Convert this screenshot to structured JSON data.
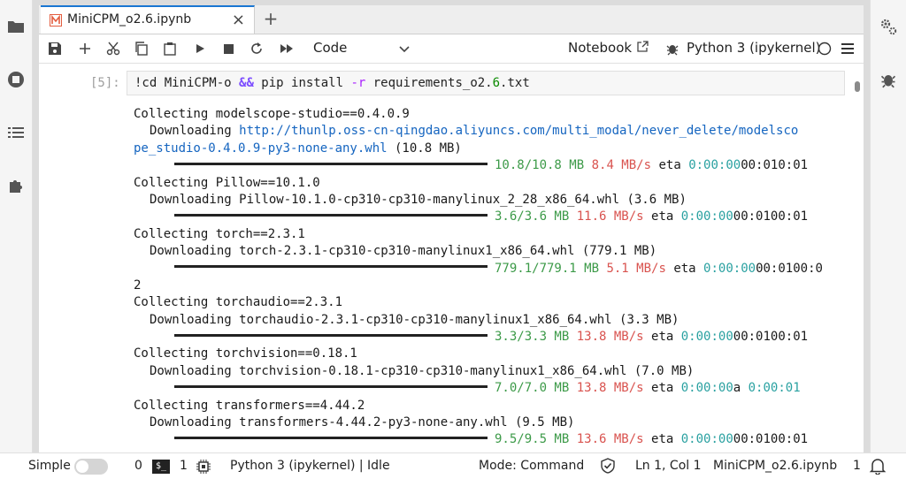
{
  "tab": {
    "label": "MiniCPM_o2.6.ipynb",
    "close": "×",
    "add": "+"
  },
  "toolbar": {
    "cell_type": "Code",
    "notebook_label": "Notebook",
    "kernel_name": "Python 3 (ipykernel)"
  },
  "cell": {
    "prompt": "[5]:",
    "cmd": "!cd MiniCPM-o ",
    "and": "&&",
    "pip": " pip install ",
    "flag": "-r",
    "req1": " requirements_o2.",
    "req_num": "6",
    "req2": ".txt"
  },
  "output": {
    "l1": "Collecting modelscope-studio==0.4.0.9",
    "l2a": "Downloading ",
    "l2b": "http://thunlp.oss-cn-qingdao.aliyuncs.com/multi_modal/never_delete/modelsco",
    "l3a": "pe_studio-0.4.0.9-py3-none-any.whl",
    "l3b": " (10.8 MB)",
    "p1": {
      "size": "10.8/10.8 MB",
      "speed": "8.4 MB/s",
      "eta": " eta ",
      "t1": "0:00:00",
      "t2": "00:010:01"
    },
    "l5": "Collecting Pillow==10.1.0",
    "l6": "Downloading Pillow-10.1.0-cp310-cp310-manylinux_2_28_x86_64.whl (3.6 MB)",
    "p2": {
      "size": "3.6/3.6 MB",
      "speed": "11.6 MB/s",
      "eta": " eta ",
      "t1": "0:00:00",
      "t2": "00:0100:01"
    },
    "l8": "Collecting torch==2.3.1",
    "l9": "Downloading torch-2.3.1-cp310-cp310-manylinux1_x86_64.whl (779.1 MB)",
    "p3": {
      "size": "779.1/779.1 MB",
      "speed": "5.1 MB/s",
      "eta": " eta ",
      "t1": "0:00:00",
      "t2": "00:0100:0"
    },
    "l11": "2",
    "l12": "Collecting torchaudio==2.3.1",
    "l13": "Downloading torchaudio-2.3.1-cp310-cp310-manylinux1_x86_64.whl (3.3 MB)",
    "p4": {
      "size": "3.3/3.3 MB",
      "speed": "13.8 MB/s",
      "eta": " eta ",
      "t1": "0:00:00",
      "t2": "00:0100:01"
    },
    "l15": "Collecting torchvision==0.18.1",
    "l16": "Downloading torchvision-0.18.1-cp310-cp310-manylinux1_x86_64.whl (7.0 MB)",
    "p5": {
      "size": "7.0/7.0 MB",
      "speed": "13.8 MB/s",
      "eta": " eta ",
      "t1": "0:00:00",
      "mid": "a ",
      "t2": "0:00:01"
    },
    "l18": "Collecting transformers==4.44.2",
    "l19": "Downloading transformers-4.44.2-py3-none-any.whl (9.5 MB)",
    "p6": {
      "size": "9.5/9.5 MB",
      "speed": "13.6 MB/s",
      "eta": " eta ",
      "t1": "0:00:00",
      "t2": "00:0100:01"
    }
  },
  "status": {
    "mode_simple": "Simple",
    "terminals": "0",
    "term_glyph": "$_",
    "kernels": "1",
    "kernel_state": "Python 3 (ipykernel) | Idle",
    "mode": "Mode: Command",
    "position": "Ln 1, Col 1",
    "filename": "MiniCPM_o2.6.ipynb",
    "notif_count": "1"
  }
}
